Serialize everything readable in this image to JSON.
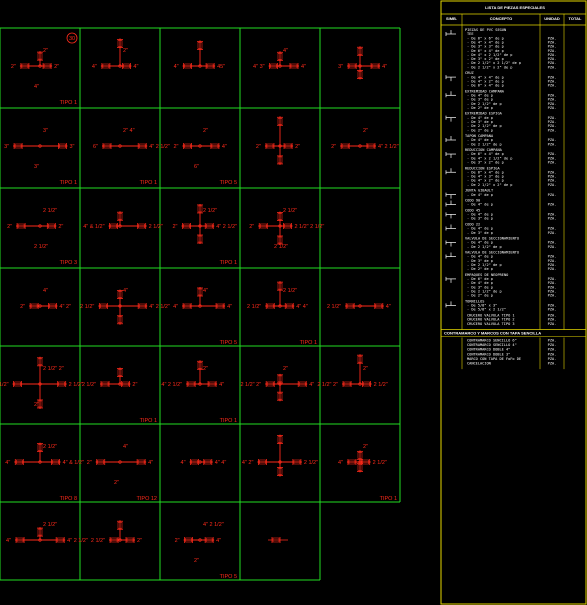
{
  "drawing": {
    "cells": [
      {
        "row": 0,
        "col": 0,
        "label": "TIPO 1",
        "badge": "30",
        "texts": [
          "2\"",
          "2\"",
          "2\"",
          "4\""
        ]
      },
      {
        "row": 0,
        "col": 1,
        "label": "",
        "badge": "",
        "texts": [
          "4\"",
          "4\"",
          "2\""
        ]
      },
      {
        "row": 0,
        "col": 2,
        "label": "",
        "badge": "",
        "texts": [
          "4\"",
          "45\""
        ]
      },
      {
        "row": 0,
        "col": 3,
        "label": "",
        "badge": "",
        "texts": [
          "4\" 3\"",
          "4\"",
          "4\""
        ]
      },
      {
        "row": 0,
        "col": 4,
        "label": "",
        "badge": "",
        "texts": [
          "3\"",
          "4\""
        ]
      },
      {
        "row": 1,
        "col": 0,
        "label": "TIPO 1",
        "badge": "",
        "texts": [
          "3\"",
          "3\"",
          "3\"",
          "3\""
        ]
      },
      {
        "row": 1,
        "col": 1,
        "label": "TIPO 1",
        "badge": "",
        "texts": [
          "6\"",
          "4\" 2 1/2\"",
          "2\" 4\""
        ]
      },
      {
        "row": 1,
        "col": 2,
        "label": "TIPO 5",
        "badge": "",
        "texts": [
          "2\"",
          "4\"",
          "2\"",
          "6\""
        ]
      },
      {
        "row": 1,
        "col": 3,
        "label": "",
        "badge": "",
        "texts": [
          "2\"",
          "2\""
        ]
      },
      {
        "row": 1,
        "col": 4,
        "label": "",
        "badge": "",
        "texts": [
          "2\"",
          "4\" 2 1/2\"",
          "2\""
        ]
      },
      {
        "row": 2,
        "col": 0,
        "label": "TIPO 3",
        "badge": "",
        "texts": [
          "2\"",
          "2\"",
          "2 1/2\"",
          "2 1/2\""
        ]
      },
      {
        "row": 2,
        "col": 1,
        "label": "",
        "badge": "",
        "texts": [
          "4\" & 1/2\"",
          "2 1/2\""
        ]
      },
      {
        "row": 2,
        "col": 2,
        "label": "TIPO 1",
        "badge": "",
        "texts": [
          "2\"",
          "4\" 2 1/2\"",
          "2 1/2\""
        ]
      },
      {
        "row": 2,
        "col": 3,
        "label": "",
        "badge": "",
        "texts": [
          "2\"",
          "2 1/2\" 2 1/2\"",
          "2 1/2\"",
          "2 1/2\""
        ]
      },
      {
        "row": 2,
        "col": 4,
        "label": "",
        "badge": "",
        "texts": []
      },
      {
        "row": 3,
        "col": 0,
        "label": "",
        "badge": "",
        "texts": [
          "2\"",
          "4\" 2\"",
          "4\""
        ]
      },
      {
        "row": 3,
        "col": 1,
        "label": "",
        "badge": "",
        "texts": [
          "2 1/2\"",
          "4\" 2 1/2\"",
          "4\""
        ]
      },
      {
        "row": 3,
        "col": 2,
        "label": "TIPO 5",
        "badge": "",
        "texts": [
          "4\"",
          "4\"",
          "4\""
        ]
      },
      {
        "row": 3,
        "col": 3,
        "label": "TIPO 1",
        "badge": "",
        "texts": [
          "2 1/2\"",
          "4\" 4\"",
          "2 1/2\""
        ]
      },
      {
        "row": 3,
        "col": 4,
        "label": "",
        "badge": "",
        "texts": [
          "2 1/2\"",
          "4\""
        ]
      },
      {
        "row": 4,
        "col": 0,
        "label": "",
        "badge": "",
        "texts": [
          "2 1/2\"",
          "2 1/2\"",
          "2 1/2\" 2\"",
          "2\""
        ]
      },
      {
        "row": 4,
        "col": 1,
        "label": "TIPO 1",
        "badge": "",
        "texts": [
          "2 1/2\"",
          "2\""
        ]
      },
      {
        "row": 4,
        "col": 2,
        "label": "TIPO 1",
        "badge": "",
        "texts": [
          "4\" 2 1/2\"",
          "4\"",
          "2\""
        ]
      },
      {
        "row": 4,
        "col": 3,
        "label": "",
        "badge": "",
        "texts": [
          "2 1/2\" 2\"",
          "4\"",
          "2\""
        ]
      },
      {
        "row": 4,
        "col": 4,
        "label": "",
        "badge": "",
        "texts": [
          "2 1/2\" 2\"",
          "2 1/2\"",
          "2\""
        ]
      },
      {
        "row": 5,
        "col": 0,
        "label": "TIPO 8",
        "badge": "",
        "texts": [
          "4\"",
          "4\" & 1/2\"",
          "2 1/2\""
        ]
      },
      {
        "row": 5,
        "col": 1,
        "label": "TIPO 12",
        "badge": "",
        "texts": [
          "2\"",
          "4\"",
          "4\"",
          "2\""
        ]
      },
      {
        "row": 5,
        "col": 2,
        "label": "",
        "badge": "",
        "texts": [
          "4\"",
          "4\" 4\""
        ]
      },
      {
        "row": 5,
        "col": 3,
        "label": "",
        "badge": "",
        "texts": [
          "4\" 2\"",
          "2 1/2\""
        ]
      },
      {
        "row": 5,
        "col": 4,
        "label": "TIPO 1",
        "badge": "",
        "texts": [
          "4\"",
          "2 1/2\"",
          "2\""
        ]
      },
      {
        "row": 6,
        "col": 0,
        "label": "",
        "badge": "",
        "texts": [
          "4\"",
          "4\" 2 1/2\"",
          "2 1/2\""
        ]
      },
      {
        "row": 6,
        "col": 1,
        "label": "",
        "badge": "",
        "texts": [
          "2 1/2\"",
          "2\""
        ]
      },
      {
        "row": 6,
        "col": 2,
        "label": "TIPO 5",
        "badge": "",
        "texts": [
          "2\"",
          "4\"",
          "4\" 2 1/2\"",
          "2\""
        ]
      },
      {
        "row": 6,
        "col": 3,
        "label": "",
        "badge": "",
        "texts": []
      }
    ]
  },
  "legend": {
    "title": "LISTA DE PIEZAS ESPECIALES",
    "columns": [
      "SIMB.",
      "CONCEPTO",
      "UNIDAD",
      "TOTAL"
    ],
    "sections": [
      {
        "header": "PIEZAS DE PVC SEGUN",
        "items": [
          {
            "text": "TEE",
            "unit": ""
          },
          {
            "text": "- De 6\" x 6\" de p",
            "unit": "PZA."
          },
          {
            "text": "- De 4\" x 4\" de p",
            "unit": "PZA."
          },
          {
            "text": "- De 3\" x 3\" de p",
            "unit": "PZA."
          },
          {
            "text": "- De 6\" x 4\" de p",
            "unit": "PZA."
          },
          {
            "text": "- De 4\" x 2 1/2\" de p",
            "unit": "PZA."
          },
          {
            "text": "- De 3\" x 2\" de p",
            "unit": "PZA."
          },
          {
            "text": "- De 2 1/2\" x 2 1/2\" de p",
            "unit": "PZA."
          },
          {
            "text": "- De 2 1/2\" x 2\" de p",
            "unit": "PZA."
          }
        ]
      },
      {
        "header": "CRUZ",
        "items": [
          {
            "text": "- De 4\" x 4\" de p",
            "unit": "PZA."
          },
          {
            "text": "- De 4\" x 2\" de p",
            "unit": "PZA."
          },
          {
            "text": "- De 6\" x 4\" de p",
            "unit": "PZA."
          }
        ]
      },
      {
        "header": "EXTREMIDAD CAMPANA",
        "items": [
          {
            "text": "- De 4\" de p",
            "unit": "PZA."
          },
          {
            "text": "- De 3\" de p",
            "unit": "PZA."
          },
          {
            "text": "- De 2 1/2\" de p",
            "unit": "PZA."
          },
          {
            "text": "- De 2\" de p",
            "unit": "PZA."
          }
        ]
      },
      {
        "header": "EXTREMIDAD ESPIGA",
        "items": [
          {
            "text": "- De 4\" de p",
            "unit": "PZA."
          },
          {
            "text": "- De 3\" de p",
            "unit": "PZA."
          },
          {
            "text": "- De 2 1/2\" de p",
            "unit": "PZA."
          },
          {
            "text": "- De 2\" de p",
            "unit": "PZA."
          }
        ]
      },
      {
        "header": "TAPON CAMPANA",
        "items": [
          {
            "text": "- De 4\" de p",
            "unit": "PZA."
          },
          {
            "text": "- De 2 1/2\" de p",
            "unit": "PZA."
          }
        ]
      },
      {
        "header": "REDUCCION CAMPANA",
        "items": [
          {
            "text": "- De 6\" x 4\" de p",
            "unit": "PZA."
          },
          {
            "text": "- De 4\" x 2 1/2\" de p",
            "unit": "PZA."
          },
          {
            "text": "- De 3\" x 2\" de p",
            "unit": "PZA."
          }
        ]
      },
      {
        "header": "REDUCCION ESPIGA",
        "items": [
          {
            "text": "- De 6\" x 4\" de p",
            "unit": "PZA."
          },
          {
            "text": "- De 4\" x 3\" de p",
            "unit": "PZA."
          },
          {
            "text": "- De 4\" x 2\" de p",
            "unit": "PZA."
          },
          {
            "text": "- De 2 1/2\" x 2\" de p",
            "unit": "PZA."
          }
        ]
      },
      {
        "header": "JUNTA GIBAULT",
        "items": [
          {
            "text": "- De 4\" de p",
            "unit": "PZA."
          }
        ]
      },
      {
        "header": "CODO 90",
        "items": [
          {
            "text": "- De 4\" de p",
            "unit": "PZA."
          }
        ]
      },
      {
        "header": "CODO 45",
        "items": [
          {
            "text": "- De 4\" de p",
            "unit": "PZA."
          },
          {
            "text": "- De 3\" de p",
            "unit": "PZA."
          }
        ]
      },
      {
        "header": "CODO 22",
        "items": [
          {
            "text": "- De 4\" de p",
            "unit": "PZA."
          },
          {
            "text": "- De 3\" de p",
            "unit": "PZA."
          }
        ]
      },
      {
        "header": "VALVULA DE SECCIONAMIENTO",
        "items": [
          {
            "text": "- De 4\" de p",
            "unit": "PZA."
          },
          {
            "text": "- De 2 1/2\" de p",
            "unit": "PZA."
          }
        ]
      },
      {
        "header": "VALVULA DE SECCIONAMIENTO",
        "items": [
          {
            "text": "- De 4\" de p",
            "unit": "PZA."
          },
          {
            "text": "- De 3\" de p",
            "unit": "PZA."
          },
          {
            "text": "- De 2 1/2\" de p",
            "unit": "PZA."
          },
          {
            "text": "- De 2\" de p",
            "unit": "PZA."
          }
        ]
      },
      {
        "header": "EMPAQUES DE NEOPRENO",
        "items": [
          {
            "text": "- De 6\" de p",
            "unit": "PZA."
          },
          {
            "text": "- De 4\" de p",
            "unit": "PZA."
          },
          {
            "text": "- De 3\" de p",
            "unit": "PZA."
          },
          {
            "text": "- De 2 1/2\" de p",
            "unit": "PZA."
          },
          {
            "text": "- De 2\" de p",
            "unit": "PZA."
          }
        ]
      },
      {
        "header": "TORNILLOS",
        "items": [
          {
            "text": "- De 5/8\" x 3\"",
            "unit": "PZA."
          },
          {
            "text": "- De 5/8\" x 2 1/2\"",
            "unit": "PZA."
          }
        ]
      },
      {
        "header": "",
        "items": [
          {
            "text": "CRUCERO VALVULA TIPO 1",
            "unit": "PZA."
          },
          {
            "text": "CRUCERO VALVULA TIPO 2",
            "unit": "PZA."
          },
          {
            "text": "CRUCERO VALVULA TIPO 3",
            "unit": "PZA."
          }
        ]
      }
    ],
    "footer_title": "CONTRAMARCO Y MARCOS CON TAPA SENCILLA",
    "footer_items": [
      {
        "text": "CONTRAMARCO SENCILLO 6\"",
        "unit": "PZA."
      },
      {
        "text": "CONTRAMARCO SENCILLO 4\"",
        "unit": "PZA."
      },
      {
        "text": "CONTRAMARCO DOBLE 4\"",
        "unit": "PZA."
      },
      {
        "text": "CONTRAMARCO DOBLE 3\"",
        "unit": "PZA."
      },
      {
        "text": "MARCO CON TAPA DE FoFo DE",
        "unit": "PZA."
      },
      {
        "text": "CANCELACION",
        "unit": "PZA."
      }
    ]
  }
}
